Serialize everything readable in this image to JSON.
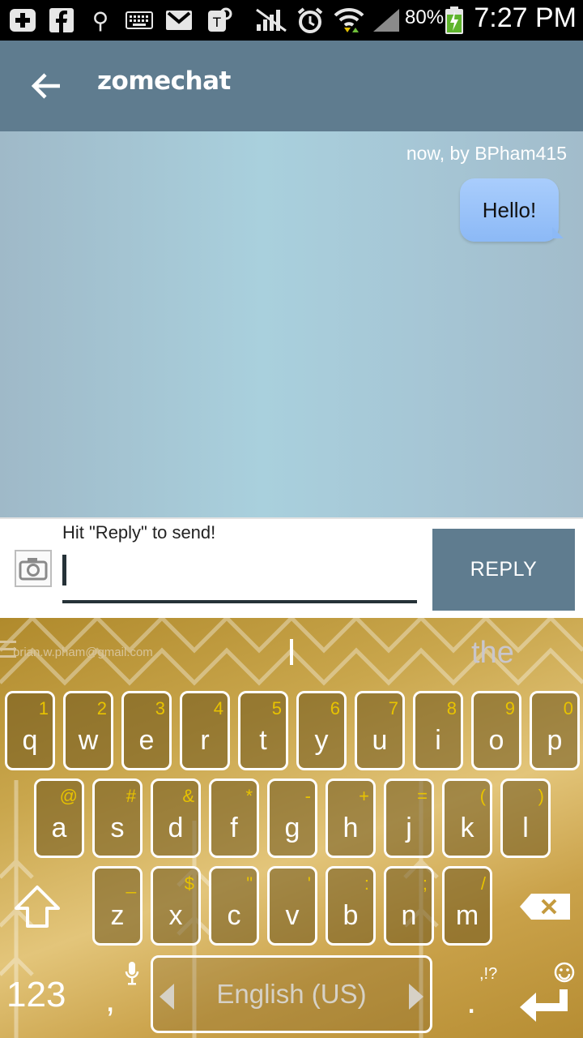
{
  "status_bar": {
    "battery_percent": "80%",
    "time": "7:27 PM",
    "icons": [
      "add-icon",
      "facebook-icon",
      "usb-icon",
      "keyboard-icon",
      "gmail-icon",
      "tmobile-icon",
      "no-signal-icon",
      "alarm-icon",
      "wifi-icon",
      "signal-icon",
      "battery-charging-icon"
    ]
  },
  "app_bar": {
    "title": "zomechat",
    "back_icon": "arrow-back-icon",
    "color": "#5f7c8f"
  },
  "chat": {
    "meta": "now, by BPham415",
    "message": "Hello!"
  },
  "compose": {
    "hint": "Hit \"Reply\" to send!",
    "input_value": "",
    "reply_label": "REPLY"
  },
  "keyboard": {
    "suggestions": {
      "email": "brian.w.pham@gmail.com",
      "current": "",
      "word": "the"
    },
    "row1": [
      {
        "main": "q",
        "alt": "1"
      },
      {
        "main": "w",
        "alt": "2"
      },
      {
        "main": "e",
        "alt": "3"
      },
      {
        "main": "r",
        "alt": "4"
      },
      {
        "main": "t",
        "alt": "5"
      },
      {
        "main": "y",
        "alt": "6"
      },
      {
        "main": "u",
        "alt": "7"
      },
      {
        "main": "i",
        "alt": "8"
      },
      {
        "main": "o",
        "alt": "9"
      },
      {
        "main": "p",
        "alt": "0"
      }
    ],
    "row2": [
      {
        "main": "a",
        "alt": "@"
      },
      {
        "main": "s",
        "alt": "#"
      },
      {
        "main": "d",
        "alt": "&"
      },
      {
        "main": "f",
        "alt": "*"
      },
      {
        "main": "g",
        "alt": "-"
      },
      {
        "main": "h",
        "alt": "+"
      },
      {
        "main": "j",
        "alt": "="
      },
      {
        "main": "k",
        "alt": "("
      },
      {
        "main": "l",
        "alt": ")"
      }
    ],
    "row3": [
      {
        "main": "z",
        "alt": "_"
      },
      {
        "main": "x",
        "alt": "$"
      },
      {
        "main": "c",
        "alt": "\""
      },
      {
        "main": "v",
        "alt": "'"
      },
      {
        "main": "b",
        "alt": ":"
      },
      {
        "main": "n",
        "alt": ";"
      },
      {
        "main": "m",
        "alt": "/"
      }
    ],
    "numbers_label": "123",
    "comma_label": ",",
    "space_label": "English (US)",
    "period_label": ".",
    "punct_label": ",!?"
  }
}
